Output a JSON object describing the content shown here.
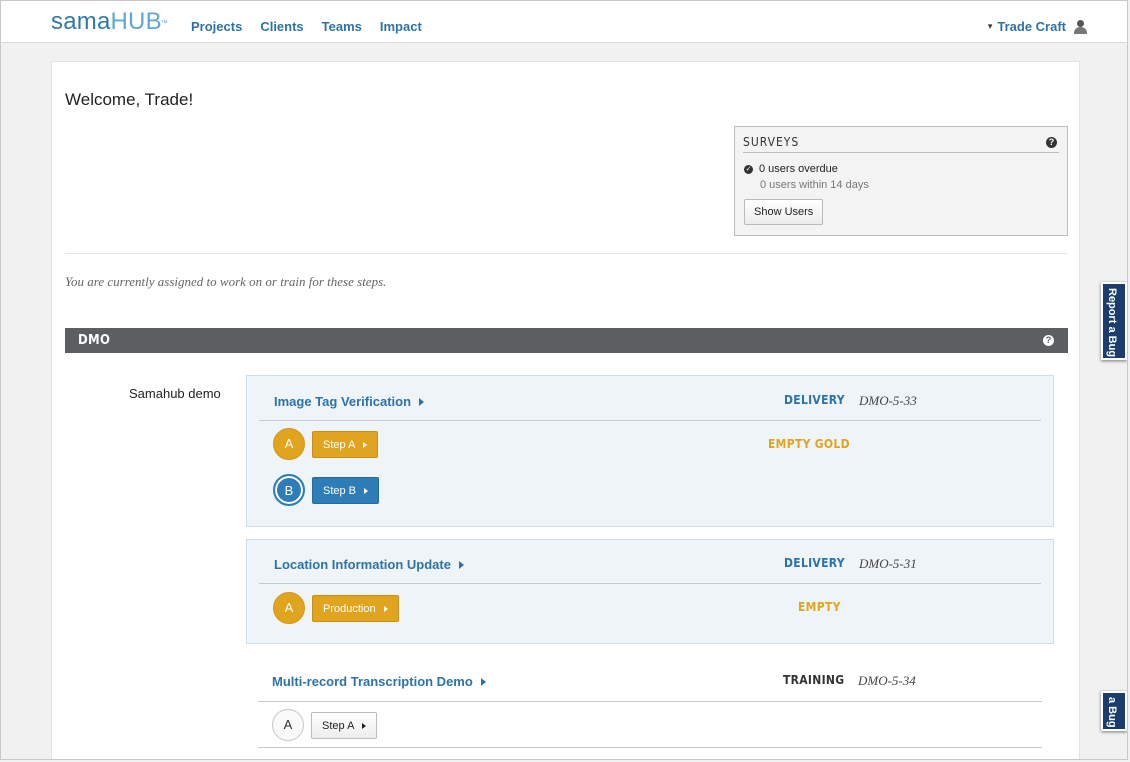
{
  "logo": {
    "part1": "sama",
    "part2": "HUB",
    "tm": "™"
  },
  "nav": {
    "projects": "Projects",
    "clients": "Clients",
    "teams": "Teams",
    "impact": "Impact"
  },
  "user": {
    "name": "Trade Craft",
    "caret": "▾"
  },
  "welcome": "Welcome, Trade!",
  "surveys": {
    "title": "SURVEYS",
    "help": "?",
    "overdue": "0 users overdue",
    "within": "0 users within 14 days",
    "show_users": "Show Users"
  },
  "assigned_text": "You are currently assigned to work on or train for these steps.",
  "group": {
    "name": "DMO",
    "help": "?"
  },
  "client": "Samahub demo",
  "projects": [
    {
      "title": "Image Tag Verification",
      "type": "DELIVERY",
      "code": "DMO-5-33",
      "steps": [
        {
          "circle": "A",
          "label": "Step A",
          "status": "EMPTY GOLD"
        },
        {
          "circle": "B",
          "label": "Step B",
          "status": ""
        }
      ]
    },
    {
      "title": "Location Information Update",
      "type": "DELIVERY",
      "code": "DMO-5-31",
      "steps": [
        {
          "circle": "A",
          "label": "Production",
          "status": "EMPTY"
        }
      ]
    },
    {
      "title": "Multi-record Transcription Demo",
      "type": "TRAINING",
      "code": "DMO-5-34",
      "steps": [
        {
          "circle": "A",
          "label": "Step A",
          "status": ""
        }
      ]
    }
  ],
  "report_bug": "Report a Bug",
  "report_bug_partial": "a Bug",
  "colors": {
    "link": "#2d73a8",
    "gold": "#e1a41f",
    "blue": "#2f7db6",
    "dark_bar": "#5c5f62",
    "bug_tab": "#1a3d6d"
  }
}
